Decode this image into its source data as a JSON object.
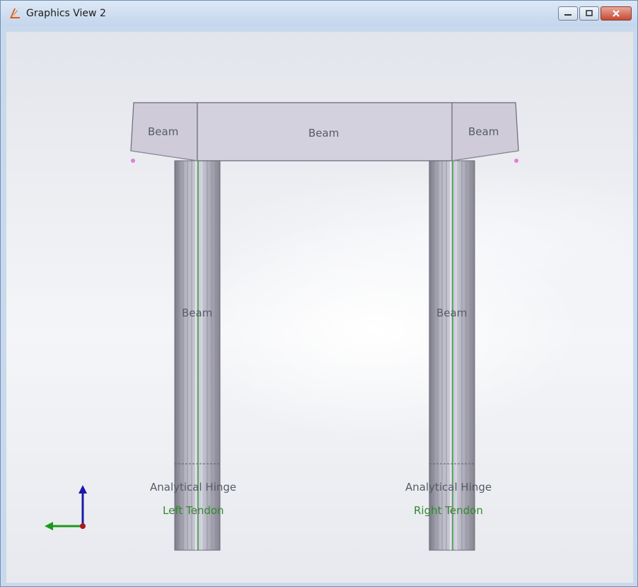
{
  "window": {
    "title": "Graphics View 2",
    "icon": "app-logo-icon",
    "controls": [
      "minimize-icon",
      "restore-icon",
      "close-icon"
    ]
  },
  "viewport": {
    "labels": {
      "beam_top_left": "Beam",
      "beam_top_center": "Beam",
      "beam_top_right": "Beam",
      "beam_column_left": "Beam",
      "beam_column_right": "Beam",
      "hinge_left": "Analytical Hinge",
      "hinge_right": "Analytical Hinge",
      "tendon_left": "Left Tendon",
      "tendon_right": "Right Tendon"
    },
    "axis_triad": {
      "icon": "axis-triad-icon",
      "colors": {
        "up": "#1a1aa8",
        "left": "#1a9a1a",
        "origin": "#aa1a1a"
      }
    },
    "colors": {
      "beam": "#c9c7d4",
      "beam_edge": "#6b6a78",
      "column": "#a8a7b4",
      "tendon_line": "#2f9a2f",
      "node": "#e07ee0"
    }
  }
}
